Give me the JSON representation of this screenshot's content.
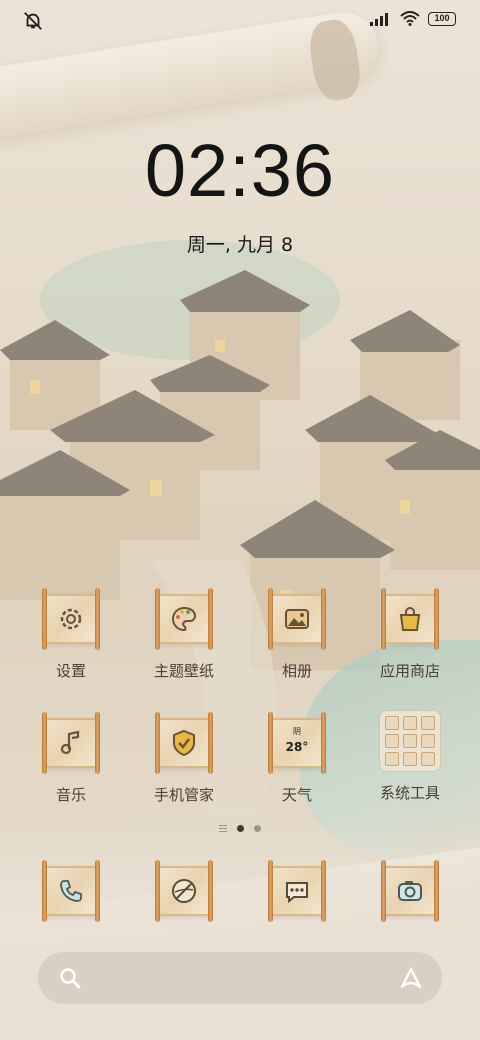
{
  "status_bar": {
    "left_icon": "mute-bell-icon",
    "right_icons": [
      "signal-icon",
      "wifi-icon",
      "battery-icon"
    ],
    "battery_level": "100"
  },
  "clock": {
    "time": "02:36",
    "date": "周一, 九月 8"
  },
  "apps": [
    {
      "label": "设置",
      "icon": "gear-icon"
    },
    {
      "label": "主题壁纸",
      "icon": "palette-icon"
    },
    {
      "label": "相册",
      "icon": "gallery-icon"
    },
    {
      "label": "应用商店",
      "icon": "shopping-bag-icon"
    },
    {
      "label": "音乐",
      "icon": "music-note-icon"
    },
    {
      "label": "手机管家",
      "icon": "shield-check-icon"
    },
    {
      "label": "天气",
      "icon": "weather-icon",
      "weather_condition": "阴",
      "temperature": "28°"
    },
    {
      "label": "系统工具",
      "icon": "folder-icon"
    }
  ],
  "page_indicator": {
    "pages": 2,
    "active": 1
  },
  "dock": [
    {
      "icon": "phone-icon"
    },
    {
      "icon": "browser-icon"
    },
    {
      "icon": "message-icon"
    },
    {
      "icon": "camera-icon"
    }
  ],
  "search_bar": {
    "left_icon": "search-icon",
    "right_icon": "assistant-icon"
  },
  "colors": {
    "accent": "#c4853f",
    "scroll_paper": "#efe1c6",
    "text": "#4b4034",
    "clock": "#141414"
  }
}
